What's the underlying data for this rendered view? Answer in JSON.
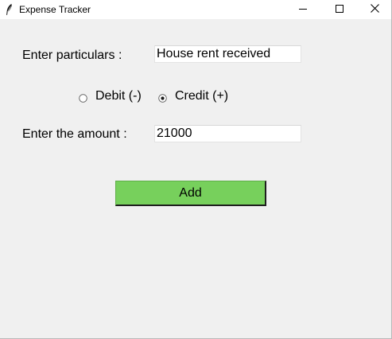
{
  "window": {
    "title": "Expense Tracker",
    "icon": "feather-icon",
    "controls": [
      "minimize-icon",
      "maximize-icon",
      "close-icon"
    ]
  },
  "form": {
    "particulars_label": "Enter particulars :",
    "particulars_value": "House rent received",
    "type_options": [
      {
        "label": "Debit (-)",
        "selected": false
      },
      {
        "label": "Credit (+)",
        "selected": true
      }
    ],
    "amount_label": "Enter the amount :",
    "amount_value": "21000",
    "add_label": "Add"
  },
  "colors": {
    "window_bg": "#f0f0f0",
    "add_button_bg": "#77d05c"
  }
}
